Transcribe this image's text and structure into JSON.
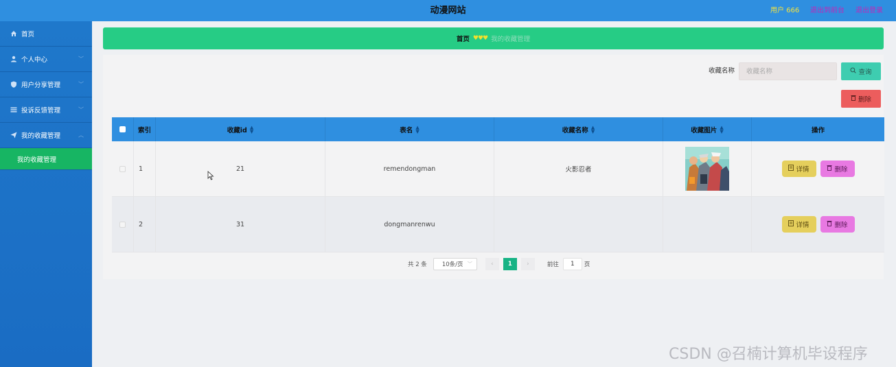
{
  "header": {
    "title": "动漫网站",
    "user": "用户 666",
    "to_front": "退出到前台",
    "logout": "退出登录"
  },
  "sidebar": {
    "items": [
      {
        "label": "首页",
        "icon": "home-icon"
      },
      {
        "label": "个人中心",
        "icon": "user-icon"
      },
      {
        "label": "用户分享管理",
        "icon": "shield-icon"
      },
      {
        "label": "投诉反馈管理",
        "icon": "list-icon"
      },
      {
        "label": "我的收藏管理",
        "icon": "send-icon"
      }
    ],
    "sub_item": "我的收藏管理"
  },
  "breadcrumb": {
    "home": "首页",
    "sep": "♥♥♥",
    "current": "我的收藏管理"
  },
  "search": {
    "label": "收藏名称",
    "placeholder": "收藏名称",
    "query_button": "查询",
    "delete_button": "删除"
  },
  "table": {
    "headers": {
      "index": "索引",
      "refid": "收藏id",
      "tablename": "表名",
      "name": "收藏名称",
      "picture": "收藏图片",
      "actions": "操作"
    },
    "rows": [
      {
        "index": "1",
        "refid": "21",
        "tablename": "remendongman",
        "name": "火影忍者",
        "detail": "详情",
        "delete": "删除"
      },
      {
        "index": "2",
        "refid": "31",
        "tablename": "dongmanrenwu",
        "name": "",
        "detail": "详情",
        "delete": "删除"
      }
    ]
  },
  "pagination": {
    "total": "共 2 条",
    "page_size": "10条/页",
    "current_page": "1",
    "goto_label": "前往",
    "goto_value": "1",
    "page_suffix": "页"
  },
  "watermark": "CSDN @召楠计算机毕设程序",
  "colors": {
    "header": "#2f8fe0",
    "sidebar": "#1f78cb",
    "active_menu": "#17b563",
    "breadcrumb": "#26cc85",
    "query_btn": "#3ecdb0",
    "delete_btn": "#ec5d5d",
    "detail_btn": "#e5cf5c",
    "row_delete_btn": "#e879e2"
  }
}
